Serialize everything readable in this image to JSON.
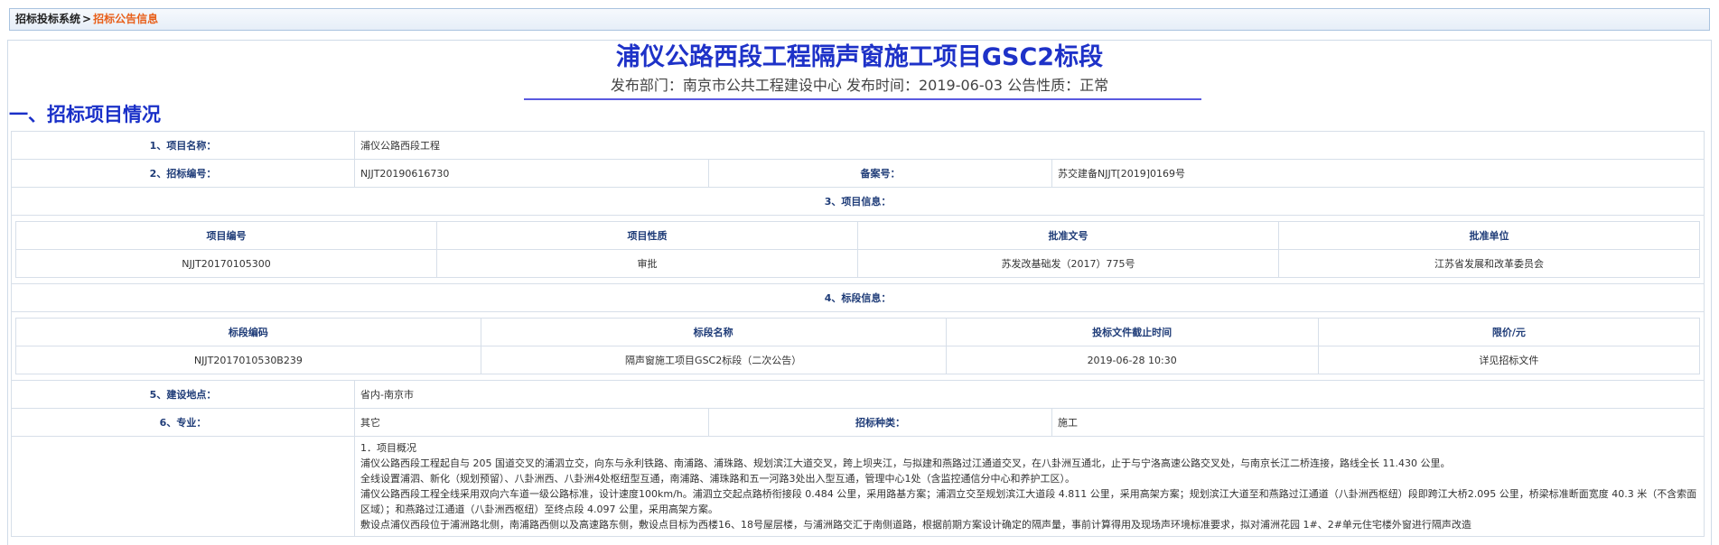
{
  "breadcrumb": {
    "root": "招标投标系统",
    "sep": ">",
    "current": "招标公告信息"
  },
  "title": "浦仪公路西段工程隔声窗施工项目GSC2标段",
  "meta": "发布部门：南京市公共工程建设中心 发布时间：2019-06-03 公告性质：正常",
  "section_title": "一、招标项目情况",
  "fields": {
    "project_name_label": "1、项目名称：",
    "project_name": "浦仪公路西段工程",
    "bid_no_label": "2、招标编号：",
    "bid_no": "NJJT20190616730",
    "record_label": "备案号：",
    "record_no": "苏交建备NJJT[2019]0169号",
    "project_info_label": "3、项目信息：",
    "section_info_label": "4、标段信息：",
    "location_label": "5、建设地点：",
    "location": "省内-南京市",
    "major_label": "6、专业：",
    "major": "其它",
    "bid_type_label": "招标种类：",
    "bid_type": "施工"
  },
  "project_info": {
    "headers": [
      "项目编号",
      "项目性质",
      "批准文号",
      "批准单位"
    ],
    "row": [
      "NJJT20170105300",
      "审批",
      "苏发改基础发（2017）775号",
      "江苏省发展和改革委员会"
    ]
  },
  "section_info": {
    "headers": [
      "标段编码",
      "标段名称",
      "投标文件截止时间",
      "限价/元"
    ],
    "row": [
      "NJJT2017010530B239",
      "隔声窗施工项目GSC2标段（二次公告）",
      "2019-06-28 10:30",
      "详见招标文件"
    ]
  },
  "overview": [
    "1．项目概况",
    "浦仪公路西段工程起自与 205 国道交叉的浦泗立交，向东与永利铁路、南浦路、浦珠路、规划滨江大道交叉，跨上坝夹江，与拟建和燕路过江通道交叉，在八卦洲互通北，止于与宁洛高速公路交叉处，与南京长江二桥连接，路线全长 11.430 公里。",
    "全线设置浦泗、新化（规划预留）、八卦洲西、八卦洲4处枢纽型互通，南浦路、浦珠路和五一河路3处出入型互通，管理中心1处（含监控通信分中心和养护工区）。",
    "浦仪公路西段工程全线采用双向六车道一级公路标准，设计速度100km/h。浦泗立交起点路桥衔接段 0.484 公里，采用路基方案；浦泗立交至规划滨江大道段 4.811 公里，采用高架方案；规划滨江大道至和燕路过江通道（八卦洲西枢纽）段即跨江大桥2.095 公里，桥梁标准断面宽度 40.3 米（不含索面区域）；和燕路过江通道（八卦洲西枢纽）至终点段 4.097 公里，采用高架方案。",
    "敷设点浦仪西段位于浦洲路北侧，南浦路西侧以及高速路东侧，敷设点目标为西楼16、18号屋层楼，与浦洲路交汇于南侧道路，根据前期方案设计确定的隔声量，事前计算得用及现场声环境标准要求，拟对浦洲花园 1#、2#单元住宅楼外窗进行隔声改造"
  ]
}
